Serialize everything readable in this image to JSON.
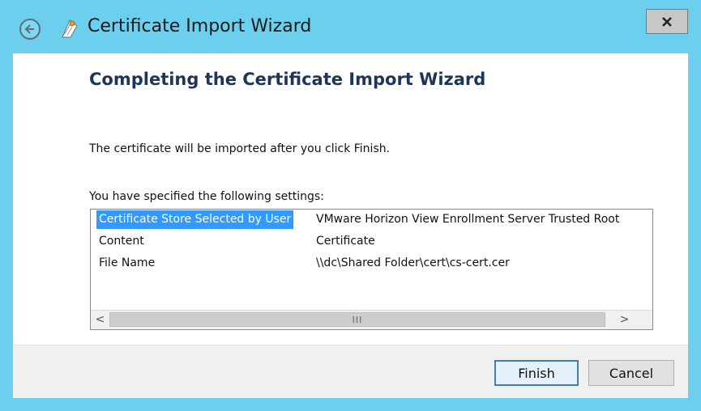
{
  "window": {
    "title": "Certificate Import Wizard",
    "close_label": "x",
    "accent": "#6ccfee"
  },
  "icons": {
    "back": "back-arrow-icon",
    "cert": "certificate-icon",
    "close": "close-icon"
  },
  "page": {
    "heading": "Completing the Certificate Import Wizard",
    "intro": "The certificate will be imported after you click Finish.",
    "settings_label": "You have specified the following settings:"
  },
  "settings": [
    {
      "name": "Certificate Store Selected by User",
      "value": "VMware Horizon View Enrollment Server Trusted Root"
    },
    {
      "name": "Content",
      "value": "Certificate"
    },
    {
      "name": "File Name",
      "value": "\\\\dc\\Shared Folder\\cert\\cs-cert.cer"
    }
  ],
  "scrollbar": {
    "left_arrow": "<",
    "right_arrow": ">",
    "grip": "III"
  },
  "buttons": {
    "finish": "Finish",
    "cancel": "Cancel"
  }
}
